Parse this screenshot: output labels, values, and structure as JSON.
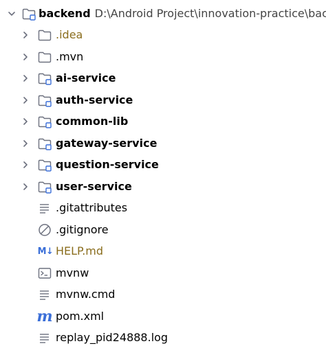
{
  "tree": {
    "root": {
      "name": "backend",
      "path": "D:\\Android Project\\innovation-practice\\back",
      "arrow_icon": "chevron-down-icon",
      "icon": "module-folder-icon"
    },
    "items": [
      {
        "label": ".idea",
        "icon": "folder-icon",
        "expandable": true
      },
      {
        "label": ".mvn",
        "icon": "folder-icon",
        "expandable": true
      },
      {
        "label": "ai-service",
        "icon": "module-folder-icon",
        "expandable": true
      },
      {
        "label": "auth-service",
        "icon": "module-folder-icon",
        "expandable": true
      },
      {
        "label": "common-lib",
        "icon": "module-folder-icon",
        "expandable": true
      },
      {
        "label": "gateway-service",
        "icon": "module-folder-icon",
        "expandable": true
      },
      {
        "label": "question-service",
        "icon": "module-folder-icon",
        "expandable": true
      },
      {
        "label": "user-service",
        "icon": "module-folder-icon",
        "expandable": true
      },
      {
        "label": ".gitattributes",
        "icon": "text-file-icon",
        "expandable": false
      },
      {
        "label": ".gitignore",
        "icon": "ignore-file-icon",
        "expandable": false
      },
      {
        "label": "HELP.md",
        "icon": "markdown-icon",
        "icon_text": "M↓",
        "expandable": false
      },
      {
        "label": "mvnw",
        "icon": "terminal-icon",
        "expandable": false
      },
      {
        "label": "mvnw.cmd",
        "icon": "text-file-icon",
        "expandable": false
      },
      {
        "label": "pom.xml",
        "icon": "maven-icon",
        "icon_text": "m",
        "expandable": false
      },
      {
        "label": "replay_pid24888.log",
        "icon": "text-file-icon",
        "expandable": false
      }
    ]
  },
  "colors": {
    "folder_stroke": "#6c707e",
    "module_badge": "#3b6fd8",
    "idea_text": "#8a6d1d",
    "help_text": "#8a6d1d",
    "path_text": "#444444"
  }
}
